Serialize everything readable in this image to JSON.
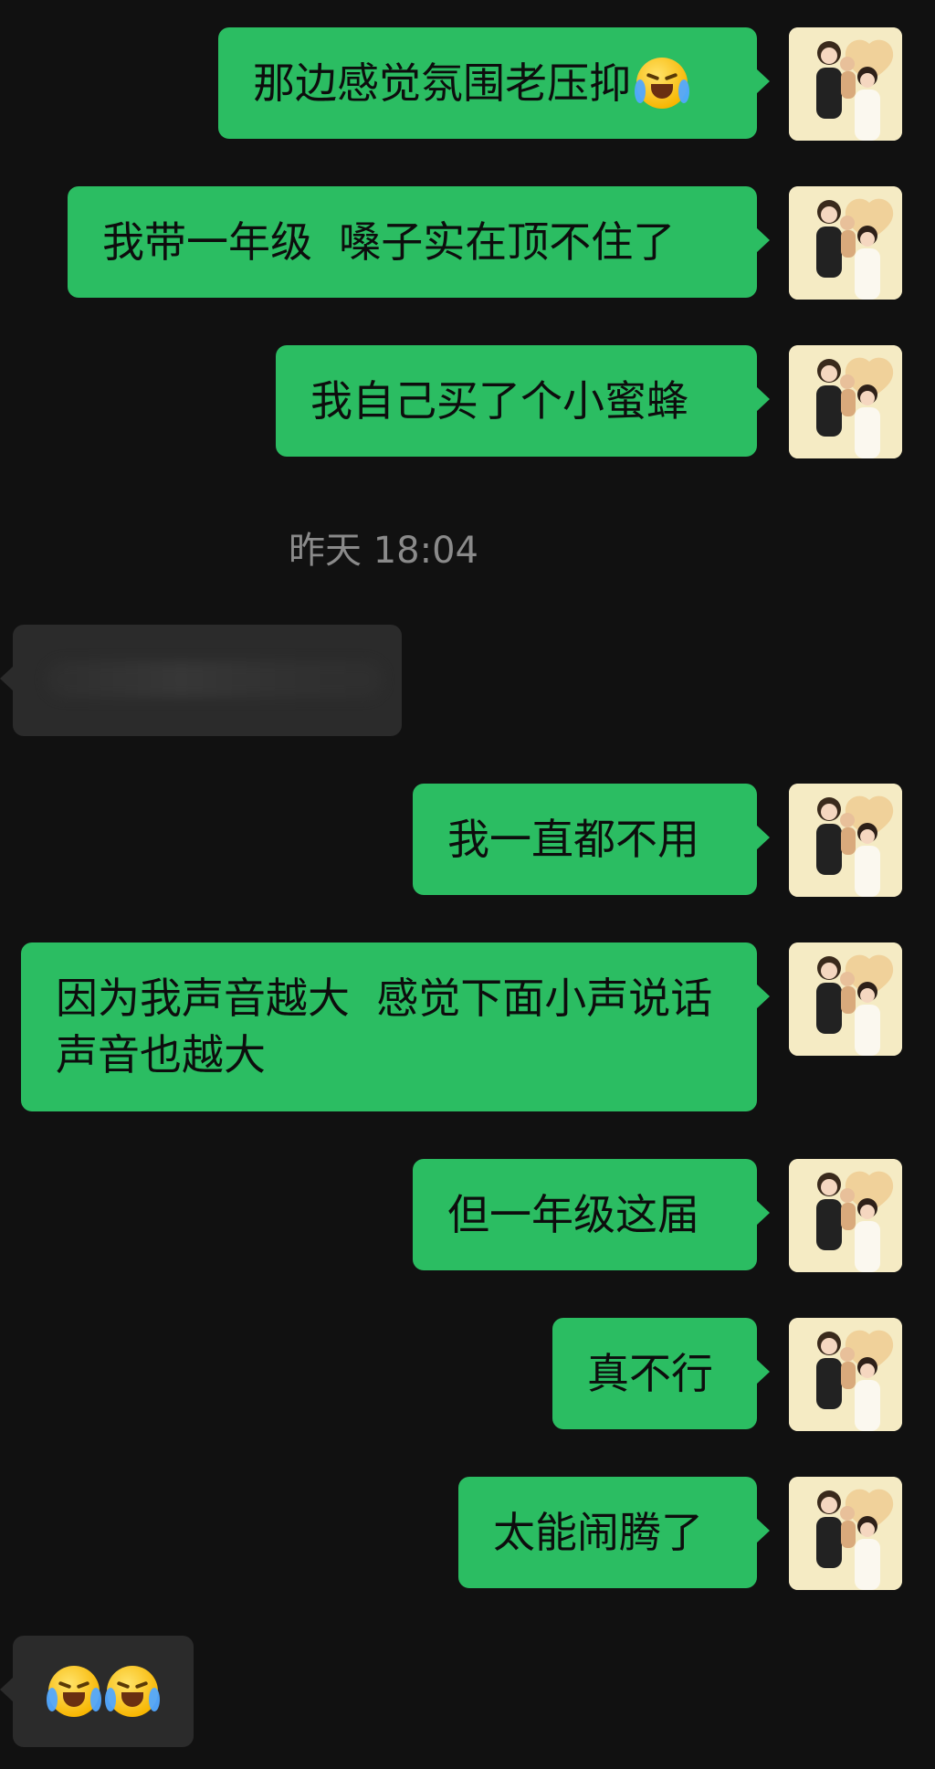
{
  "chat": {
    "timestamp": "昨天 18:04",
    "messages": [
      {
        "side": "outgoing",
        "text": "那边感觉氛围老压抑",
        "emoji": "crying-laughing-emoji"
      },
      {
        "side": "outgoing",
        "text": "我带一年级  嗓子实在顶不住了"
      },
      {
        "side": "outgoing",
        "text": "我自己买了个小蜜蜂"
      },
      {
        "side": "incoming",
        "text": ""
      },
      {
        "side": "outgoing",
        "text": "我一直都不用"
      },
      {
        "side": "outgoing",
        "text": "因为我声音越大  感觉下面小声说话声音也越大"
      },
      {
        "side": "outgoing",
        "text": "但一年级这届"
      },
      {
        "side": "outgoing",
        "text": "真不行"
      },
      {
        "side": "outgoing",
        "text": "太能闹腾了"
      },
      {
        "side": "incoming",
        "text": "",
        "emoji": [
          "crying-laughing-emoji",
          "crying-laughing-emoji"
        ]
      }
    ]
  },
  "colors": {
    "background": "#111111",
    "outgoing_bubble": "#2bbd62",
    "incoming_bubble": "#2b2b2b",
    "timestamp_text": "#8a8a8a"
  }
}
